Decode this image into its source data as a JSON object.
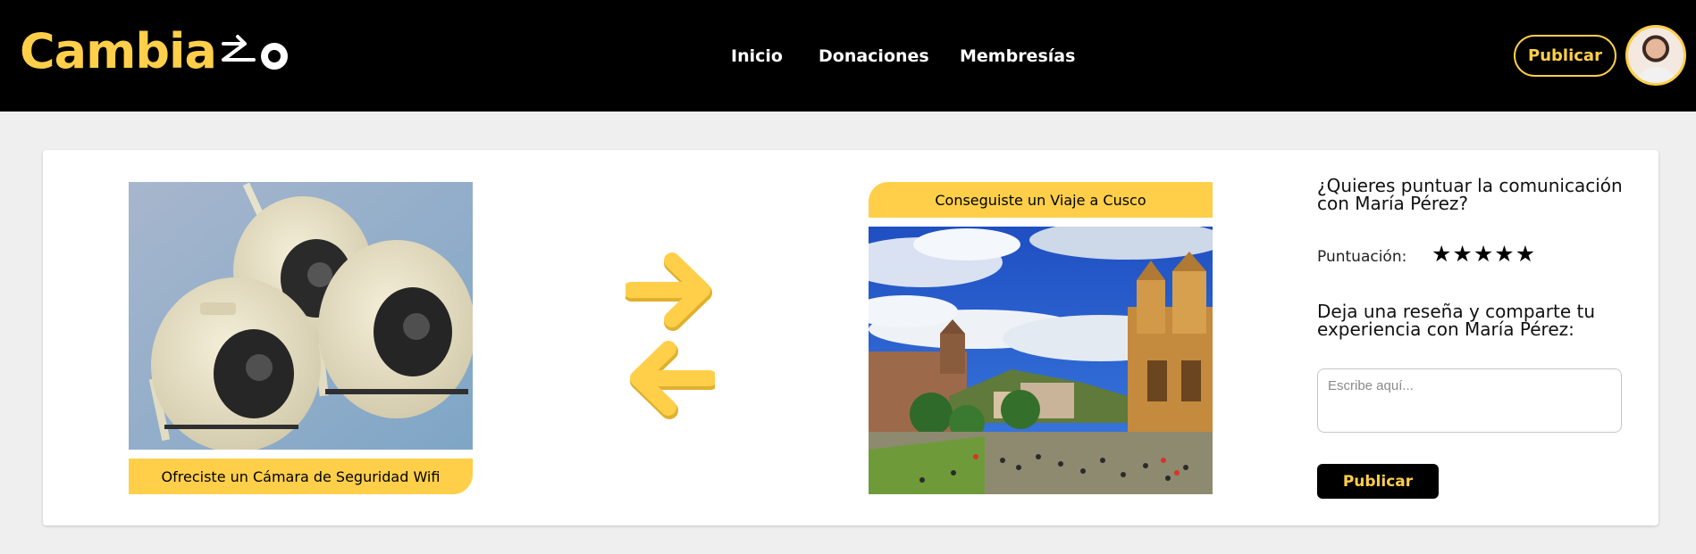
{
  "header": {
    "logo_text": "Cambia",
    "nav": [
      {
        "label": "Inicio"
      },
      {
        "label": "Donaciones"
      },
      {
        "label": "Membresías"
      }
    ],
    "publish_label": "Publicar",
    "avatar_icon": "user-avatar"
  },
  "exchange": {
    "offered_label": "Ofreciste un Cámara de Seguridad Wifi",
    "received_label": "Conseguiste un Viaje a Cusco",
    "arrow_icons": [
      "arrow-right-icon",
      "arrow-left-icon"
    ]
  },
  "rating": {
    "question": "¿Quieres puntuar la comunicación con María Pérez?",
    "score_label": "Puntuación:",
    "stars": [
      "★",
      "★",
      "★",
      "★",
      "★"
    ],
    "star_count": 5,
    "review_prompt": "Deja una reseña y comparte tu experiencia con María Pérez:",
    "review_placeholder": "Escribe aquí...",
    "submit_label": "Publicar"
  },
  "colors": {
    "accent": "#FFCF4A",
    "header_bg": "#000000",
    "page_bg": "#EFEFEF"
  }
}
